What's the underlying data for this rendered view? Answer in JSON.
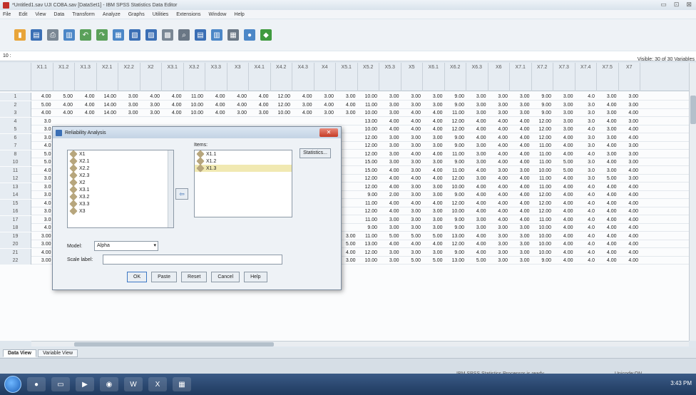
{
  "window": {
    "title": "*Untitled1.sav UJI COBA.sav [DataSet1] - IBM SPSS Statistics Data Editor",
    "controls": [
      "▭",
      "⊡",
      "⊠"
    ]
  },
  "menubar": {
    "items": [
      "File",
      "Edit",
      "View",
      "Data",
      "Transform",
      "Analyze",
      "Graphs",
      "Utilities",
      "Extensions",
      "Window",
      "Help"
    ]
  },
  "toolbar": {
    "icons": [
      "open-icon",
      "save-icon",
      "print-icon",
      "dialog-recall-icon",
      "undo-icon",
      "redo-icon",
      "goto-case-icon",
      "goto-variable-icon",
      "variables-icon",
      "run-descriptives-icon",
      "find-icon",
      "insert-cases-icon",
      "insert-variable-icon",
      "split-file-icon",
      "select-cases-icon",
      "value-labels-icon"
    ]
  },
  "cellref": {
    "value": "10 :"
  },
  "visible": {
    "text": "Visible: 30 of 30 Variables"
  },
  "grid": {
    "columns": [
      "X1.1",
      "X1.2",
      "X1.3",
      "X2.1",
      "X2.2",
      "X2",
      "X3.1",
      "X3.2",
      "X3.3",
      "X3",
      "X4.1",
      "X4.2",
      "X4.3",
      "X4",
      "X5.1",
      "X5.2",
      "X5.3",
      "X5",
      "X6.1",
      "X6.2",
      "X6.3",
      "X6",
      "X7.1",
      "X7.2",
      "X7.3",
      "X7.4",
      "X7.5",
      "X7"
    ],
    "rows": [
      {
        "n": "1",
        "v": [
          "4.00",
          "5.00",
          "4.00",
          "14.00",
          "3.00",
          "4.00",
          "4.00",
          "11.00",
          "4.00",
          "4.00",
          "4.00",
          "12.00",
          "4.00",
          "3.00",
          "3.00",
          "10.00",
          "3.00",
          "3.00",
          "3.00",
          "9.00",
          "3.00",
          "3.00",
          "3.00",
          "9.00",
          "3.00",
          "4.0",
          "3.00",
          "3.00",
          "3.00",
          "16.00"
        ]
      },
      {
        "n": "2",
        "v": [
          "5.00",
          "4.00",
          "4.00",
          "14.00",
          "3.00",
          "3.00",
          "4.00",
          "10.00",
          "4.00",
          "4.00",
          "4.00",
          "12.00",
          "3.00",
          "4.00",
          "4.00",
          "11.00",
          "3.00",
          "3.00",
          "3.00",
          "9.00",
          "3.00",
          "3.00",
          "3.00",
          "9.00",
          "3.00",
          "3.0",
          "4.00",
          "3.00",
          "3.00",
          "16.00"
        ]
      },
      {
        "n": "3",
        "v": [
          "4.00",
          "4.00",
          "4.00",
          "14.00",
          "3.00",
          "3.00",
          "4.00",
          "10.00",
          "4.00",
          "3.00",
          "3.00",
          "10.00",
          "4.00",
          "3.00",
          "3.00",
          "10.00",
          "3.00",
          "4.00",
          "4.00",
          "11.00",
          "3.00",
          "3.00",
          "3.00",
          "9.00",
          "3.00",
          "3.0",
          "3.00",
          "4.00",
          "4.00",
          "17.00"
        ]
      },
      {
        "n": "4",
        "v": [
          "3.0",
          "",
          "",
          "",
          "",
          "",
          "",
          "",
          "",
          "",
          "",
          "",
          "",
          "",
          "",
          "13.00",
          "4.00",
          "4.00",
          "4.00",
          "12.00",
          "4.00",
          "4.00",
          "4.00",
          "12.00",
          "3.00",
          "3.0",
          "4.00",
          "3.00",
          "3.00",
          "16.00"
        ]
      },
      {
        "n": "5",
        "v": [
          "3.0",
          "",
          "",
          "",
          "",
          "",
          "",
          "",
          "",
          "",
          "",
          "",
          "",
          "",
          "",
          "10.00",
          "4.00",
          "4.00",
          "4.00",
          "12.00",
          "4.00",
          "4.00",
          "4.00",
          "12.00",
          "3.00",
          "4.0",
          "3.00",
          "4.00",
          "4.00",
          "17.00"
        ]
      },
      {
        "n": "6",
        "v": [
          "3.0",
          "",
          "",
          "",
          "",
          "",
          "",
          "",
          "",
          "",
          "",
          "",
          "",
          "",
          "",
          "12.00",
          "3.00",
          "3.00",
          "3.00",
          "9.00",
          "4.00",
          "4.00",
          "4.00",
          "12.00",
          "4.00",
          "3.0",
          "3.00",
          "4.00",
          "4.00",
          "18.00"
        ]
      },
      {
        "n": "7",
        "v": [
          "4.0",
          "",
          "",
          "",
          "",
          "",
          "",
          "",
          "",
          "",
          "",
          "",
          "",
          "",
          "",
          "12.00",
          "3.00",
          "3.00",
          "3.00",
          "9.00",
          "3.00",
          "4.00",
          "4.00",
          "11.00",
          "4.00",
          "3.0",
          "4.00",
          "3.00",
          "3.00",
          "17.00"
        ]
      },
      {
        "n": "8",
        "v": [
          "5.0",
          "",
          "",
          "",
          "",
          "",
          "",
          "",
          "",
          "",
          "",
          "",
          "",
          "",
          "",
          "12.00",
          "3.00",
          "4.00",
          "4.00",
          "11.00",
          "3.00",
          "4.00",
          "4.00",
          "11.00",
          "4.00",
          "4.0",
          "3.00",
          "3.00",
          "3.00",
          "17.00"
        ]
      },
      {
        "n": "10",
        "v": [
          "5.0",
          "",
          "",
          "",
          "",
          "",
          "",
          "",
          "",
          "",
          "",
          "",
          "",
          "",
          "",
          "15.00",
          "3.00",
          "3.00",
          "3.00",
          "9.00",
          "3.00",
          "4.00",
          "4.00",
          "11.00",
          "5.00",
          "3.0",
          "4.00",
          "3.00",
          "3.00",
          "18.00"
        ]
      },
      {
        "n": "11",
        "v": [
          "4.0",
          "",
          "",
          "",
          "",
          "",
          "",
          "",
          "",
          "",
          "",
          "",
          "",
          "",
          "",
          "15.00",
          "4.00",
          "3.00",
          "4.00",
          "11.00",
          "4.00",
          "3.00",
          "3.00",
          "10.00",
          "5.00",
          "3.0",
          "3.00",
          "4.00",
          "4.00",
          "19.00"
        ]
      },
      {
        "n": "12",
        "v": [
          "3.0",
          "",
          "",
          "",
          "",
          "",
          "",
          "",
          "",
          "",
          "",
          "",
          "",
          "",
          "",
          "12.00",
          "4.00",
          "4.00",
          "4.00",
          "12.00",
          "3.00",
          "4.00",
          "4.00",
          "11.00",
          "4.00",
          "3.0",
          "5.00",
          "3.00",
          "3.00",
          "18.00"
        ]
      },
      {
        "n": "13",
        "v": [
          "3.0",
          "",
          "",
          "",
          "",
          "",
          "",
          "",
          "",
          "",
          "",
          "",
          "",
          "",
          "",
          "12.00",
          "4.00",
          "3.00",
          "3.00",
          "10.00",
          "4.00",
          "4.00",
          "4.00",
          "11.00",
          "4.00",
          "4.0",
          "4.00",
          "4.00",
          "4.00",
          "20.00"
        ]
      },
      {
        "n": "14",
        "v": [
          "3.0",
          "",
          "",
          "",
          "",
          "",
          "",
          "",
          "",
          "",
          "",
          "",
          "",
          "",
          "",
          "9.00",
          "2.00",
          "3.00",
          "3.00",
          "9.00",
          "4.00",
          "4.00",
          "4.00",
          "12.00",
          "4.00",
          "4.0",
          "4.00",
          "4.00",
          "4.00",
          "20.00"
        ]
      },
      {
        "n": "15",
        "v": [
          "4.0",
          "",
          "",
          "",
          "",
          "",
          "",
          "",
          "",
          "",
          "",
          "",
          "",
          "",
          "",
          "11.00",
          "4.00",
          "4.00",
          "4.00",
          "12.00",
          "4.00",
          "4.00",
          "4.00",
          "12.00",
          "4.00",
          "4.0",
          "4.00",
          "4.00",
          "4.00",
          "20.00"
        ]
      },
      {
        "n": "16",
        "v": [
          "3.0",
          "",
          "",
          "",
          "",
          "",
          "",
          "",
          "",
          "",
          "",
          "",
          "",
          "",
          "",
          "12.00",
          "4.00",
          "3.00",
          "3.00",
          "10.00",
          "4.00",
          "4.00",
          "4.00",
          "12.00",
          "4.00",
          "4.0",
          "4.00",
          "4.00",
          "4.00",
          "20.00"
        ]
      },
      {
        "n": "17",
        "v": [
          "3.0",
          "",
          "",
          "",
          "",
          "",
          "",
          "",
          "",
          "",
          "",
          "",
          "",
          "",
          "",
          "11.00",
          "3.00",
          "3.00",
          "3.00",
          "9.00",
          "3.00",
          "4.00",
          "4.00",
          "11.00",
          "4.00",
          "4.0",
          "4.00",
          "4.00",
          "4.00",
          "20.00"
        ]
      },
      {
        "n": "18",
        "v": [
          "4.0",
          "",
          "",
          "",
          "",
          "",
          "",
          "",
          "",
          "",
          "",
          "",
          "",
          "",
          "",
          "9.00",
          "3.00",
          "3.00",
          "3.00",
          "9.00",
          "3.00",
          "3.00",
          "3.00",
          "10.00",
          "4.00",
          "4.0",
          "4.00",
          "4.00",
          "4.00",
          "20.00"
        ]
      },
      {
        "n": "19",
        "v": [
          "3.00",
          "5.00",
          "3.00",
          "14.00",
          "4.00",
          "5.00",
          "4.00",
          "13.00",
          "4.00",
          "4.00",
          "4.00",
          "12.00",
          "5.00",
          "3.00",
          "3.00",
          "11.00",
          "5.00",
          "5.00",
          "5.00",
          "13.00",
          "4.00",
          "3.00",
          "3.00",
          "10.00",
          "4.00",
          "4.0",
          "4.00",
          "4.00",
          "4.00",
          "20.00"
        ]
      },
      {
        "n": "20",
        "v": [
          "3.00",
          "4.00",
          "5.00",
          "14.00",
          "4.00",
          "3.00",
          "4.00",
          "11.00",
          "4.00",
          "4.00",
          "4.00",
          "12.00",
          "3.00",
          "5.00",
          "5.00",
          "13.00",
          "4.00",
          "4.00",
          "4.00",
          "12.00",
          "4.00",
          "3.00",
          "3.00",
          "10.00",
          "4.00",
          "4.0",
          "4.00",
          "4.00",
          "4.00",
          "20.00"
        ]
      },
      {
        "n": "21",
        "v": [
          "4.00",
          "3.00",
          "5.00",
          "14.00",
          "3.00",
          "4.00",
          "4.00",
          "11.00",
          "4.00",
          "4.00",
          "4.00",
          "12.00",
          "4.00",
          "4.00",
          "4.00",
          "12.00",
          "3.00",
          "3.00",
          "3.00",
          "9.00",
          "4.00",
          "3.00",
          "3.00",
          "10.00",
          "4.00",
          "4.0",
          "4.00",
          "4.00",
          "4.00",
          "20.00"
        ]
      },
      {
        "n": "22",
        "v": [
          "3.00",
          "3.00",
          "5.00",
          "14.00",
          "3.00",
          "3.00",
          "3.00",
          "9.00",
          "4.00",
          "4.00",
          "4.00",
          "12.00",
          "4.00",
          "3.00",
          "3.00",
          "10.00",
          "3.00",
          "5.00",
          "5.00",
          "13.00",
          "5.00",
          "3.00",
          "3.00",
          "9.00",
          "4.00",
          "4.0",
          "4.00",
          "4.00",
          "4.00",
          "20.00"
        ]
      }
    ]
  },
  "dialog": {
    "title": "Reliability Analysis",
    "source_items": [
      "X1",
      "X2.1",
      "X2.2",
      "X2.3",
      "X2",
      "X3.1",
      "X3.2",
      "X3.3",
      "X3"
    ],
    "items_label": "Items:",
    "target_items": [
      "X1.1",
      "X1.2",
      "X1.3"
    ],
    "statistics_label": "Statistics...",
    "model_label": "Model:",
    "model_value": "Alpha",
    "scale_label": "Scale label:",
    "buttons": {
      "ok": "OK",
      "paste": "Paste",
      "reset": "Reset",
      "cancel": "Cancel",
      "help": "Help"
    }
  },
  "viewtabs": {
    "data_view": "Data View",
    "variable_view": "Variable View"
  },
  "statusbar": {
    "processor": "IBM SPSS Statistics Processor is ready",
    "encoding": "Unicode:ON"
  },
  "taskbar": {
    "clock": "3:43 PM"
  }
}
